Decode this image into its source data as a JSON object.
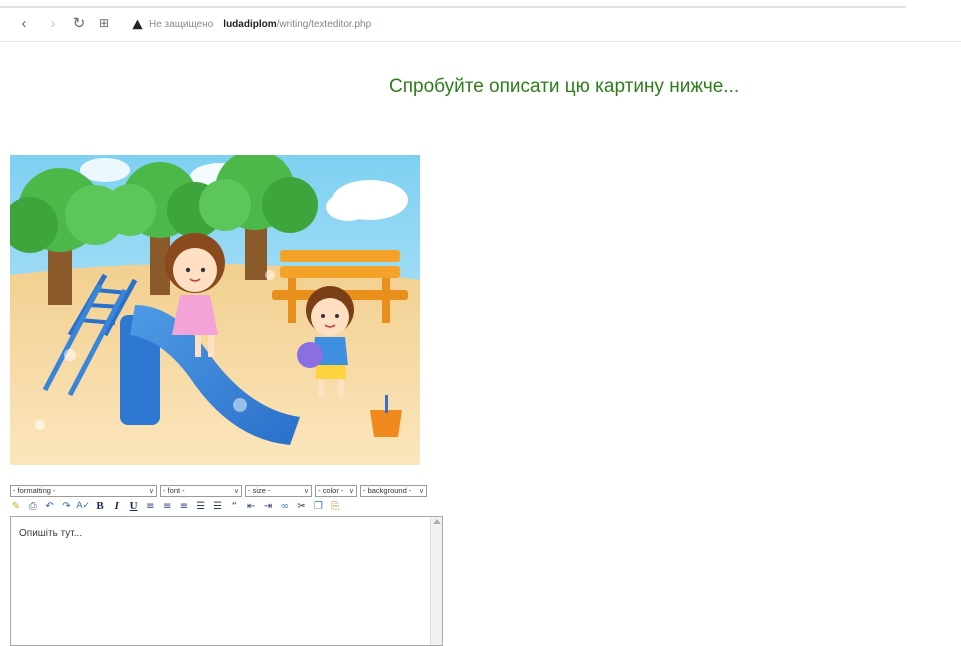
{
  "browser": {
    "security_label": "Не защищено",
    "url_host": "ludadiplom",
    "url_path": "/writing/texteditor.php"
  },
  "page": {
    "heading": "Спробуйте описати цю картину нижче..."
  },
  "editor": {
    "selects": {
      "formatting": "- formatting -",
      "font": "- font -",
      "size": "- size -",
      "color": "- color -",
      "background": "- background -"
    },
    "toolbar_icons": [
      "brush-icon",
      "printer-icon",
      "undo-icon",
      "redo-icon",
      "spellcheck-icon",
      "bold-icon",
      "italic-icon",
      "underline-icon",
      "align-left-icon",
      "align-center-icon",
      "align-right-icon",
      "ordered-list-icon",
      "unordered-list-icon",
      "blockquote-icon",
      "outdent-icon",
      "indent-icon",
      "link-icon",
      "cut-icon",
      "copy-icon",
      "paste-icon"
    ],
    "bold_label": "B",
    "italic_label": "I",
    "underline_label": "U",
    "body_text": "Опишіть тут..."
  },
  "colors": {
    "heading": "#2e7d1b",
    "warning": "#202124"
  }
}
